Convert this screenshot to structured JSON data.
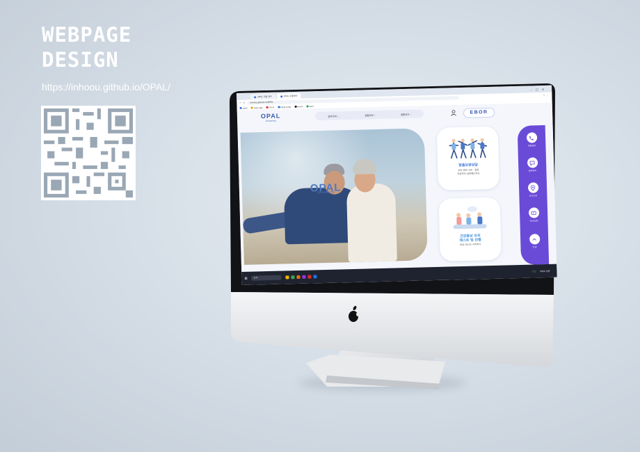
{
  "portfolio": {
    "title_line1": "WEBPAGE",
    "title_line2": "DESIGN",
    "url": "https://inhoou.github.io/OPAL/"
  },
  "browser": {
    "tabs": [
      {
        "label": "OPAL 오팔 메인",
        "active": false
      },
      {
        "label": "OPAL 오팔메인",
        "active": true
      }
    ],
    "address": "inhoou.github.io/OPAL",
    "bookmarks": [
      "삼성전",
      "트렌드 공유",
      "Gmail",
      "대학생 마케팅",
      "Notion",
      "Bard"
    ]
  },
  "site": {
    "logo": "OPAL",
    "logo_sub": "University",
    "nav": [
      {
        "label": "입주안내",
        "icon": "chevron-down-icon"
      },
      {
        "label": "생활정보",
        "icon": "chevron-right-icon"
      },
      {
        "label": "생활공간",
        "icon": "chevron-right-icon"
      }
    ],
    "partner_badge": "EBOR",
    "hero_logo": "OPAL",
    "hero_logo_sub": "University",
    "cards": [
      {
        "title": "맞춤요양상담",
        "desc_line1": "요양 관련 고민 · 질문",
        "desc_line2": "전문적인 상담해드려요"
      },
      {
        "title_line1": "건강증상 모의",
        "title_line2": "테스트 및 진행",
        "desc": "증상 테스트 시작하기"
      }
    ],
    "quick_menu": [
      {
        "label": "전화상담",
        "icon": "phone-icon"
      },
      {
        "label": "입주문의",
        "icon": "chat-icon"
      },
      {
        "label": "오시는길",
        "icon": "map-pin-icon"
      },
      {
        "label": "Youtube",
        "icon": "youtube-icon"
      },
      {
        "label": "TOP",
        "icon": "chevron-up-icon"
      }
    ]
  },
  "taskbar": {
    "search_label": "검색",
    "weather": "-1°C",
    "status": "대체로 맑음"
  },
  "colors": {
    "accent_purple": "#6a4bd8",
    "brand_blue": "#3a5aa8",
    "background": "#d3dce5"
  }
}
